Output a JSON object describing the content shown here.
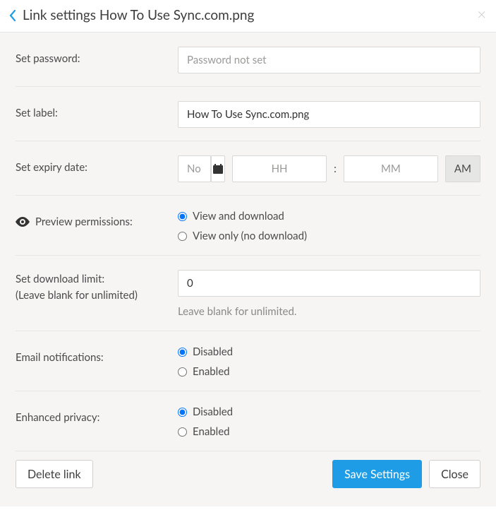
{
  "header": {
    "title": "Link settings How To Use Sync.com.png"
  },
  "password": {
    "label": "Set password:",
    "placeholder": "Password not set",
    "value": ""
  },
  "label_field": {
    "label": "Set label:",
    "value": "How To Use Sync.com.png"
  },
  "expiry": {
    "label": "Set expiry date:",
    "date_placeholder": "No expiry date",
    "date_value": "",
    "hh_placeholder": "HH",
    "hh_value": "",
    "mm_placeholder": "MM",
    "mm_value": "",
    "ampm": "AM"
  },
  "permissions": {
    "label": "Preview permissions:",
    "option_view_download": "View and download",
    "option_view_only": "View only (no download)"
  },
  "download_limit": {
    "label": "Set download limit:",
    "sub_label": "(Leave blank for unlimited)",
    "value": "0",
    "hint": "Leave blank for unlimited."
  },
  "email_notifications": {
    "label": "Email notifications:",
    "option_disabled": "Disabled",
    "option_enabled": "Enabled"
  },
  "enhanced_privacy": {
    "label": "Enhanced privacy:",
    "option_disabled": "Disabled",
    "option_enabled": "Enabled"
  },
  "buttons": {
    "delete": "Delete link",
    "save": "Save Settings",
    "close": "Close"
  }
}
